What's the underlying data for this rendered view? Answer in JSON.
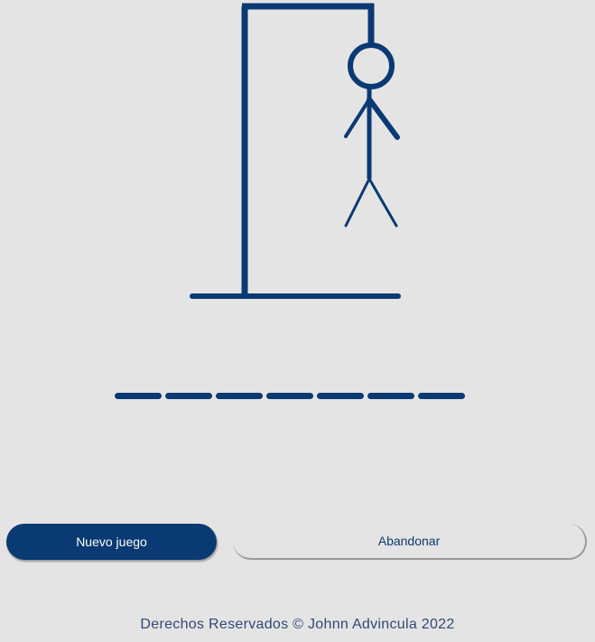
{
  "game": {
    "word_length": 7,
    "colors": {
      "accent": "#0a3a73",
      "background": "#e5e4e5"
    }
  },
  "buttons": {
    "new_game_label": "Nuevo juego",
    "abandon_label": "Abandonar"
  },
  "footer": {
    "text": "Derechos Reservados © Johnn Advincula 2022"
  }
}
